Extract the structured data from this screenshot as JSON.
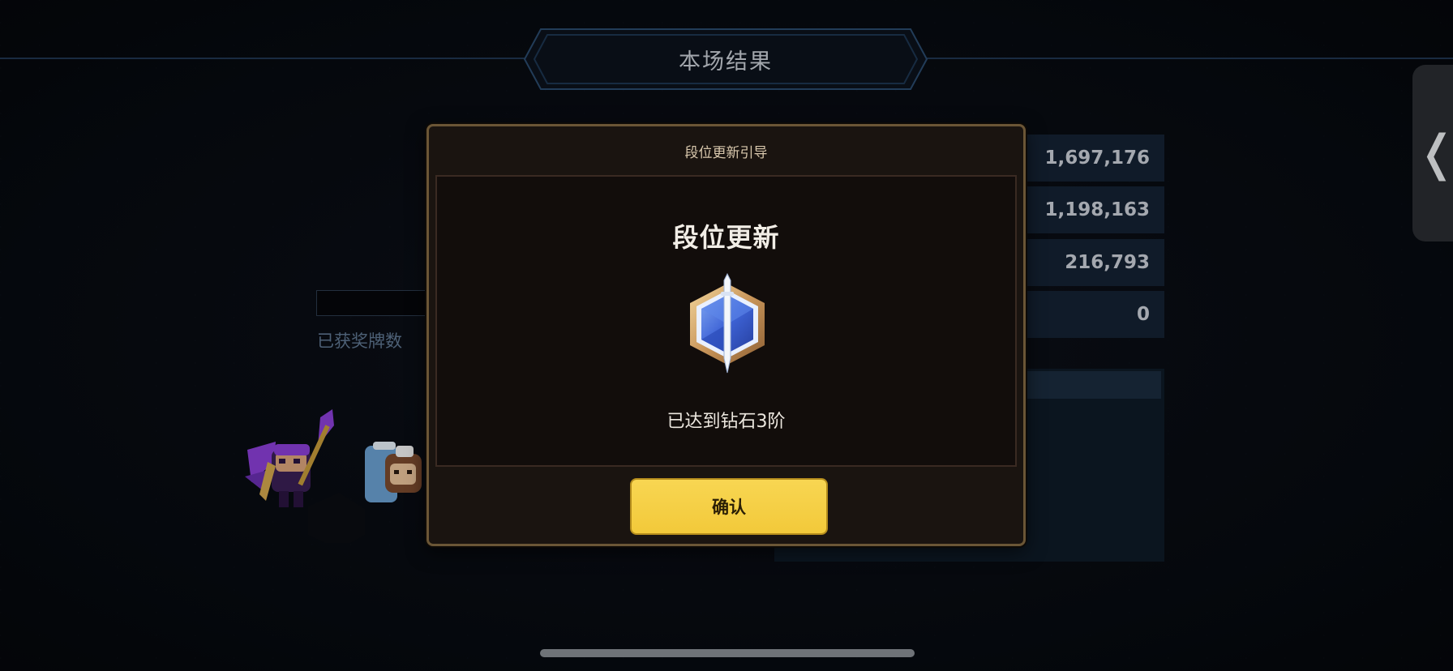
{
  "header": {
    "title": "本场结果"
  },
  "scores": [
    "1,697,176",
    "1,198,163",
    "216,793",
    "0"
  ],
  "left_panel": {
    "medal_count_label": "已获奖牌数"
  },
  "side_tab": {
    "glyph": "❬"
  },
  "modal": {
    "title": "段位更新引导",
    "heading": "段位更新",
    "emblem_icon": "diamond-rank-emblem-icon",
    "description": "已达到钻石3阶",
    "confirm_label": "确认"
  },
  "colors": {
    "confirm_button": "#f5cf45",
    "modal_border": "#6b5636",
    "score_panel": "#142232"
  }
}
